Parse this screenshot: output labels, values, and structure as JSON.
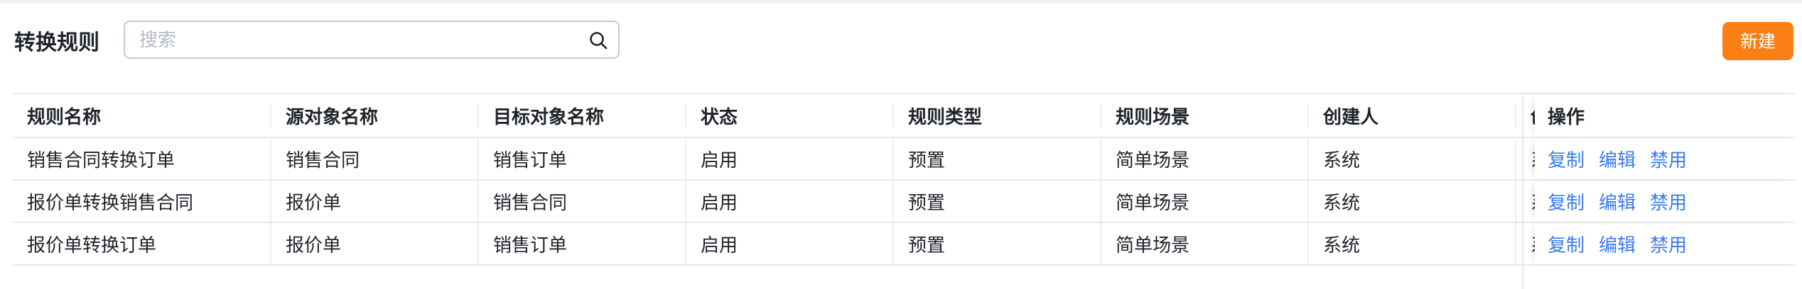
{
  "header": {
    "title": "转换规则",
    "search_placeholder": "搜索",
    "search_value": "",
    "new_button": "新建"
  },
  "table": {
    "columns": [
      "规则名称",
      "源对象名称",
      "目标对象名称",
      "状态",
      "规则类型",
      "规则场景",
      "创建人",
      "创",
      "操作"
    ],
    "rows": [
      {
        "cells": [
          "销售合同转换订单",
          "销售合同",
          "销售订单",
          "启用",
          "预置",
          "简单场景",
          "系统",
          "系"
        ],
        "actions": [
          "复制",
          "编辑",
          "禁用"
        ]
      },
      {
        "cells": [
          "报价单转换销售合同",
          "报价单",
          "销售合同",
          "启用",
          "预置",
          "简单场景",
          "系统",
          "系"
        ],
        "actions": [
          "复制",
          "编辑",
          "禁用"
        ]
      },
      {
        "cells": [
          "报价单转换订单",
          "报价单",
          "销售订单",
          "启用",
          "预置",
          "简单场景",
          "系统",
          "系"
        ],
        "actions": [
          "复制",
          "编辑",
          "禁用"
        ]
      }
    ]
  },
  "colors": {
    "accent": "#fa7f14",
    "link": "#3a7bf0",
    "border": "#e6e8eb"
  },
  "icons": {
    "search": "search-icon"
  }
}
